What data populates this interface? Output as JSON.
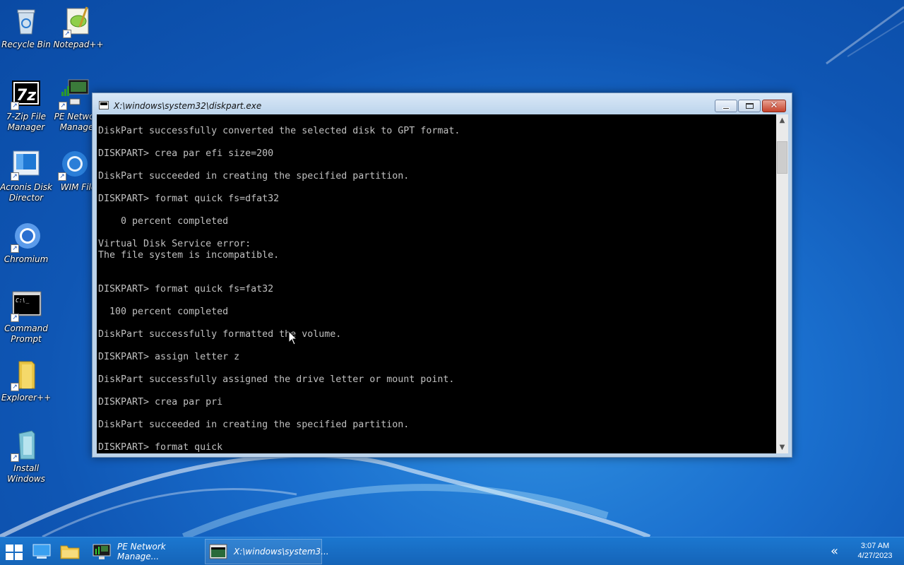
{
  "desktop": {
    "icons": [
      {
        "label": "Recycle Bin",
        "icon": "recycle-bin-icon"
      },
      {
        "label": "Notepad++",
        "icon": "notepad-plus-plus-icon"
      },
      {
        "label": "7-Zip File Manager",
        "icon": "seven-zip-icon"
      },
      {
        "label": "PE Network Manager",
        "icon": "network-manager-icon"
      },
      {
        "label": "Acronis Disk Director",
        "icon": "acronis-icon"
      },
      {
        "label": "WIM File",
        "icon": "wim-icon"
      },
      {
        "label": "Chromium",
        "icon": "chromium-icon"
      },
      {
        "label": "Command Prompt",
        "icon": "command-prompt-icon"
      },
      {
        "label": "Explorer++",
        "icon": "explorer-plus-plus-icon"
      },
      {
        "label": "Install Windows",
        "icon": "install-windows-icon"
      }
    ]
  },
  "window": {
    "title": "X:\\windows\\system32\\diskpart.exe",
    "minimize": "minimize",
    "maximize": "maximize",
    "close": "✕"
  },
  "console": {
    "lines": [
      "DiskPart successfully converted the selected disk to GPT format.",
      "",
      "DISKPART> crea par efi size=200",
      "",
      "DiskPart succeeded in creating the specified partition.",
      "",
      "DISKPART> format quick fs=dfat32",
      "",
      "    0 percent completed",
      "",
      "Virtual Disk Service error:",
      "The file system is incompatible.",
      "",
      "",
      "DISKPART> format quick fs=fat32",
      "",
      "  100 percent completed",
      "",
      "DiskPart successfully formatted the volume.",
      "",
      "DISKPART> assign letter z",
      "",
      "DiskPart successfully assigned the drive letter or mount point.",
      "",
      "DISKPART> crea par pri",
      "",
      "DiskPart succeeded in creating the specified partition.",
      "",
      "DISKPART> format quick"
    ]
  },
  "taskbar": {
    "items": [
      {
        "label": "PE Network Manage...",
        "icon": "network-manager-icon"
      },
      {
        "label": "X:\\windows\\system3...",
        "icon": "console-icon"
      }
    ],
    "clock": {
      "time": "3:07 AM",
      "date": "4/27/2023"
    },
    "tray_chevron": "«"
  }
}
